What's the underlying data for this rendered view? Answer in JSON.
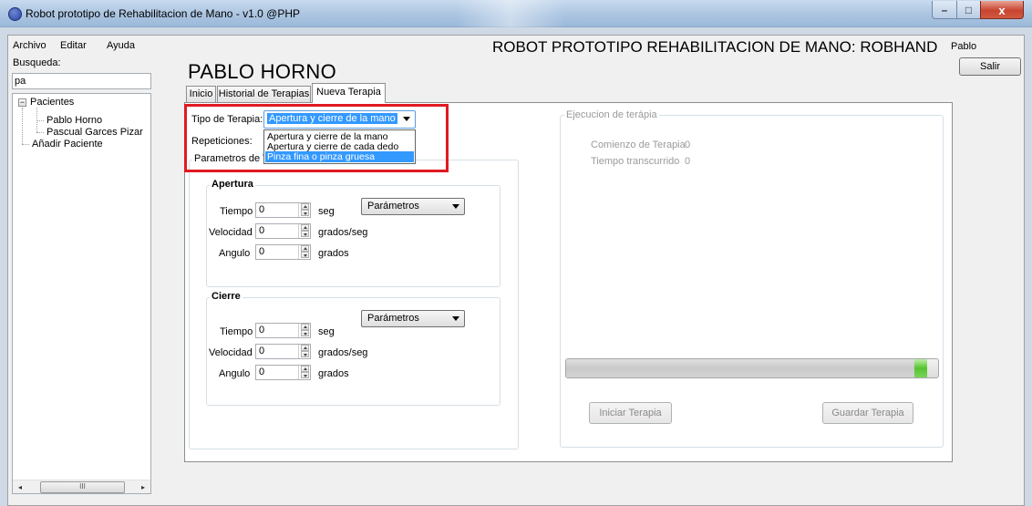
{
  "window": {
    "title": "Robot prototipo de Rehabilitacion de Mano - v1.0 @PHP",
    "controls": {
      "minimize": "–",
      "maximize": "□",
      "close": "x"
    }
  },
  "menu": [
    "Archivo",
    "Editar",
    "Ayuda"
  ],
  "app_heading": "ROBOT PROTOTIPO REHABILITACION DE MANO: ROBHAND",
  "user": {
    "name": "Pablo",
    "logout_label": "Salir"
  },
  "search": {
    "label": "Busqueda:",
    "value": "pa"
  },
  "tree": {
    "root": "Pacientes",
    "expander": "−",
    "children": [
      "Pablo Horno",
      "Pascual  Garces Pizar"
    ],
    "add_item": "Añadir Paciente"
  },
  "tree_scrollbar": {
    "left": "◂",
    "right": "▸",
    "thumb": "III"
  },
  "patient_name": "PABLO HORNO",
  "tabs": [
    "Inicio",
    "Historial de Terapias",
    "Nueva Terapia"
  ],
  "active_tab": "Nueva Terapia",
  "therapy": {
    "type_label": "Tipo de Terapia:",
    "type_selected": "Apertura y cierre de la mano",
    "type_options": [
      "Apertura y cierre de la mano",
      "Apertura y cierre de cada dedo",
      "Pinza fina o pinza gruesa"
    ],
    "highlighted_option": "Pinza fina o pinza gruesa",
    "repetitions_label": "Repeticiones:",
    "params_group": "Parametros de Terapia",
    "params_group_visible": "Parametros de T",
    "params_group_partial": "erapia"
  },
  "apertura": {
    "title": "Apertura",
    "preset": "Parámetros",
    "tiempo": {
      "label": "Tiempo",
      "value": "0",
      "unit": "seg"
    },
    "velocidad": {
      "label": "Velocidad",
      "value": "0",
      "unit": "grados/seg"
    },
    "angulo": {
      "label": "Angulo",
      "value": "0",
      "unit": "grados"
    }
  },
  "cierre": {
    "title": "Cierre",
    "preset": "Parámetros",
    "tiempo": {
      "label": "Tiempo",
      "value": "0",
      "unit": "seg"
    },
    "velocidad": {
      "label": "Velocidad",
      "value": "0",
      "unit": "grados/seg"
    },
    "angulo": {
      "label": "Angulo",
      "value": "0",
      "unit": "grados"
    }
  },
  "execution": {
    "group_title": "Ejecucion de terápia",
    "start_label": "Comienzo de Terapia",
    "start_value": "0",
    "elapsed_label": "Tiempo transcurrido",
    "elapsed_value": "0",
    "progress_fraction": 0.97,
    "start_button": "Iniciar Terapia",
    "save_button": "Guardar Terapia"
  },
  "colors": {
    "highlight_border": "#e01a22",
    "selection": "#3399ff",
    "progress_tip": "#55c22f"
  }
}
